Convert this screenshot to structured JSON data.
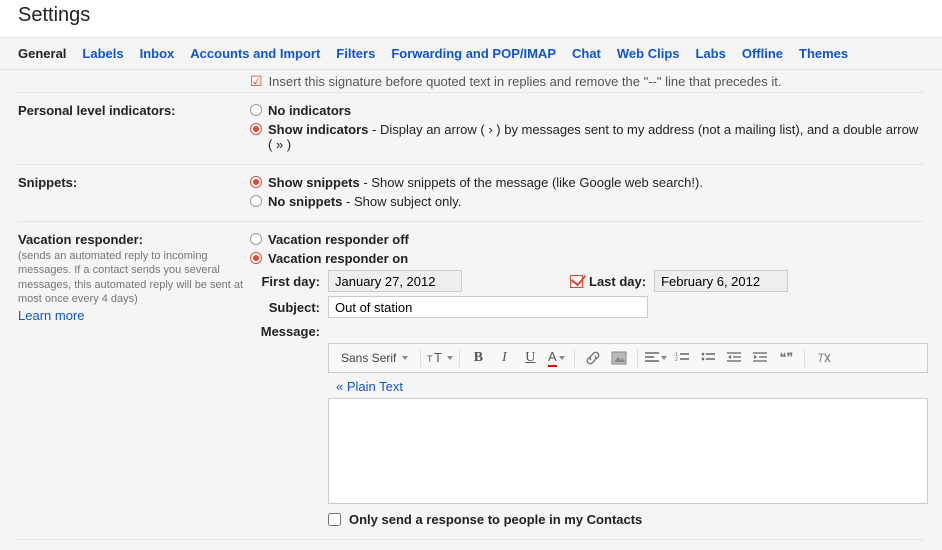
{
  "page_title": "Settings",
  "tabs": [
    "General",
    "Labels",
    "Inbox",
    "Accounts and Import",
    "Filters",
    "Forwarding and POP/IMAP",
    "Chat",
    "Web Clips",
    "Labs",
    "Offline",
    "Themes"
  ],
  "active_tab": "General",
  "signature_truncated": "Insert this signature before quoted text in replies and remove the \"--\" line that precedes it.",
  "personal": {
    "title": "Personal level indicators:",
    "opt1": {
      "bold": "No indicators"
    },
    "opt2": {
      "bold": "Show indicators",
      "rest": " - Display an arrow ( › ) by messages sent to my address (not a mailing list), and a double arrow ( » )"
    }
  },
  "snippets": {
    "title": "Snippets:",
    "opt1": {
      "bold": "Show snippets",
      "rest": " - Show snippets of the message (like Google web search!)."
    },
    "opt2": {
      "bold": "No snippets",
      "rest": " - Show subject only."
    }
  },
  "vacation": {
    "title": "Vacation responder:",
    "desc": "(sends an automated reply to incoming messages. If a contact sends you several messages, this automated reply will be sent at most once every 4 days)",
    "learn": "Learn more",
    "opt_off": "Vacation responder off",
    "opt_on": "Vacation responder on",
    "firstday_label": "First day:",
    "firstday_value": "January 27, 2012",
    "lastday_label": "Last day:",
    "lastday_value": "February 6, 2012",
    "subject_label": "Subject:",
    "subject_value": "Out of station",
    "message_label": "Message:",
    "font_name": "Sans Serif",
    "plain_text": "« Plain Text",
    "contacts_only": "Only send a response to people in my Contacts"
  },
  "toolbar_icons": {
    "bold": "B",
    "italic": "I",
    "underline": "U",
    "colorA": "A",
    "quote": "❝❞"
  }
}
